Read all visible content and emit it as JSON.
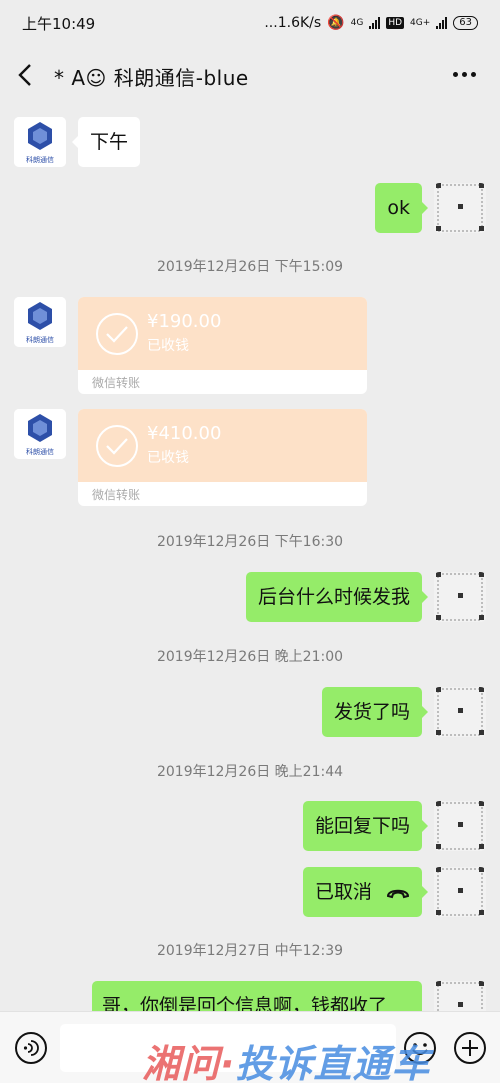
{
  "status_bar": {
    "time": "上午10:49",
    "speed": "...1.6K/s",
    "network_1": "4G",
    "hd": "HD",
    "network_2": "4G+",
    "battery": "63"
  },
  "header": {
    "title": "* A☺ 科朗通信-blue"
  },
  "contact": {
    "avatar_text": "科朗通信"
  },
  "messages": [
    {
      "type": "text",
      "side": "left",
      "text": "下午"
    },
    {
      "type": "text",
      "side": "right",
      "text": "ok"
    },
    {
      "type": "time",
      "text": "2019年12月26日 下午15:09"
    },
    {
      "type": "transfer",
      "side": "left",
      "amount": "¥190.00",
      "status": "已收钱",
      "footer": "微信转账"
    },
    {
      "type": "transfer",
      "side": "left",
      "amount": "¥410.00",
      "status": "已收钱",
      "footer": "微信转账"
    },
    {
      "type": "time",
      "text": "2019年12月26日 下午16:30"
    },
    {
      "type": "text",
      "side": "right",
      "text": "后台什么时候发我"
    },
    {
      "type": "time",
      "text": "2019年12月26日 晚上21:00"
    },
    {
      "type": "text",
      "side": "right",
      "text": "发货了吗"
    },
    {
      "type": "time",
      "text": "2019年12月26日 晚上21:44"
    },
    {
      "type": "text",
      "side": "right",
      "text": "能回复下吗"
    },
    {
      "type": "call",
      "side": "right",
      "text": "已取消"
    },
    {
      "type": "time",
      "text": "2019年12月27日 中午12:39"
    },
    {
      "type": "text",
      "side": "right",
      "text": "哥，你倒是回个信息啊，钱都收了"
    }
  ],
  "input": {
    "placeholder": ""
  },
  "watermark": {
    "part1": "湘问·",
    "part2": "投诉直通车"
  },
  "colors": {
    "background": "#ededed",
    "bubble_self": "#95ec69",
    "bubble_other": "#ffffff",
    "transfer_card": "#fde1c8"
  }
}
